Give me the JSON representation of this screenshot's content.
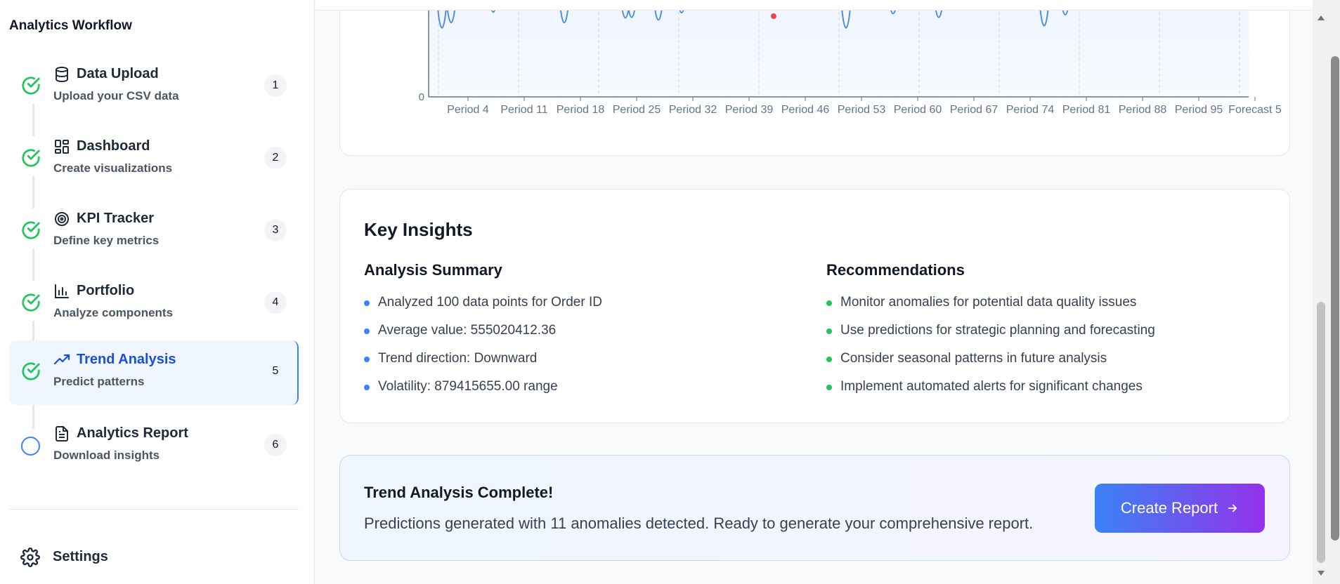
{
  "sidebar": {
    "title": "Analytics Workflow",
    "steps": [
      {
        "title": "Data Upload",
        "subtitle": "Upload your CSV data",
        "number": "1",
        "icon": "database-icon",
        "status": "complete"
      },
      {
        "title": "Dashboard",
        "subtitle": "Create visualizations",
        "number": "2",
        "icon": "dashboard-grid-icon",
        "status": "complete"
      },
      {
        "title": "KPI Tracker",
        "subtitle": "Define key metrics",
        "number": "3",
        "icon": "target-icon",
        "status": "complete"
      },
      {
        "title": "Portfolio",
        "subtitle": "Analyze components",
        "number": "4",
        "icon": "bar-chart-icon",
        "status": "complete"
      },
      {
        "title": "Trend Analysis",
        "subtitle": "Predict patterns",
        "number": "5",
        "icon": "trending-up-icon",
        "status": "active"
      },
      {
        "title": "Analytics Report",
        "subtitle": "Download insights",
        "number": "6",
        "icon": "file-text-icon",
        "status": "pending"
      }
    ],
    "settings_label": "Settings"
  },
  "chart_data": {
    "type": "line",
    "y_tick_labels": [
      "0"
    ],
    "x_tick_labels": [
      "Period 4",
      "Period 11",
      "Period 18",
      "Period 25",
      "Period 32",
      "Period 39",
      "Period 46",
      "Period 53",
      "Period 60",
      "Period 67",
      "Period 74",
      "Period 81",
      "Period 88",
      "Period 95",
      "Forecast 5"
    ],
    "grid": true,
    "series_color": "#4a90e2",
    "anomaly_color": "#ef4444"
  },
  "insights": {
    "title": "Key Insights",
    "summary_title": "Analysis Summary",
    "summary_items": [
      "Analyzed 100 data points for Order ID",
      "Average value: 555020412.36",
      "Trend direction: Downward",
      "Volatility: 879415655.00 range"
    ],
    "recommendations_title": "Recommendations",
    "recommendation_items": [
      "Monitor anomalies for potential data quality issues",
      "Use predictions for strategic planning and forecasting",
      "Consider seasonal patterns in future analysis",
      "Implement automated alerts for significant changes"
    ]
  },
  "completion": {
    "title": "Trend Analysis Complete!",
    "message": "Predictions generated with 11 anomalies detected. Ready to generate your comprehensive report.",
    "button_label": "Create Report"
  },
  "colors": {
    "accent": "#3b82f6",
    "success": "#22c55e",
    "gradient_end": "#9333ea"
  }
}
